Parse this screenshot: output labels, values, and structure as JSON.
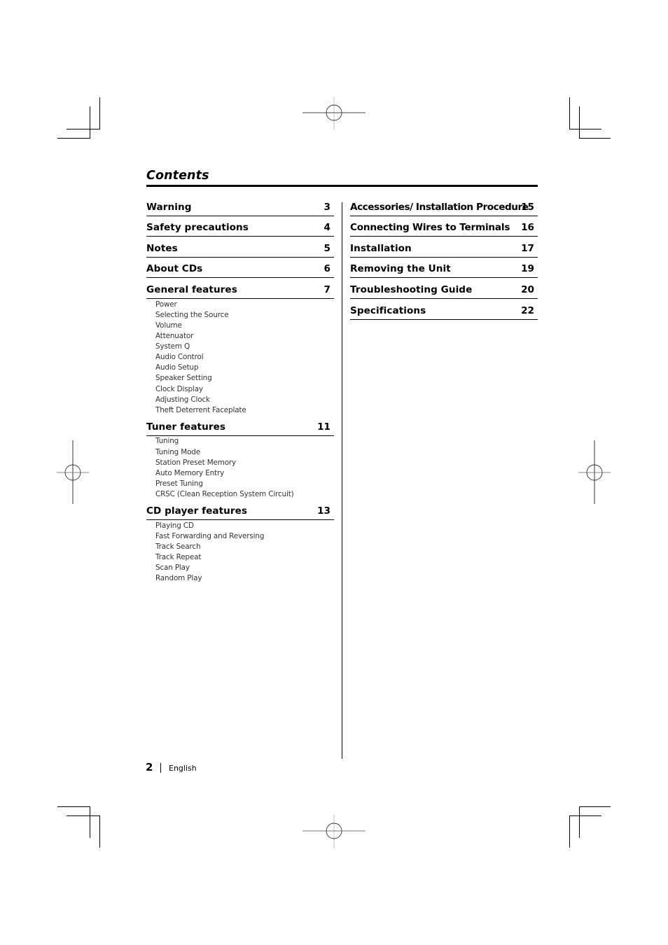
{
  "title": "Contents",
  "left_column": {
    "entries": [
      {
        "label": "Warning",
        "page": "3",
        "subitems": []
      },
      {
        "label": "Safety precautions",
        "page": "4",
        "subitems": []
      },
      {
        "label": "Notes",
        "page": "5",
        "subitems": []
      },
      {
        "label": "About CDs",
        "page": "6",
        "subitems": []
      },
      {
        "label": "General features",
        "page": "7",
        "subitems": [
          "Power",
          "Selecting the Source",
          "Volume",
          "Attenuator",
          "System Q",
          "Audio Control",
          "Audio Setup",
          "Speaker Setting",
          "Clock Display",
          "Adjusting Clock",
          "Theft Deterrent Faceplate"
        ]
      },
      {
        "label": "Tuner features",
        "page": "11",
        "subitems": [
          "Tuning",
          "Tuning Mode",
          "Station Preset Memory",
          "Auto Memory Entry",
          "Preset Tuning",
          "CRSC (Clean Reception System Circuit)"
        ]
      },
      {
        "label": "CD player features",
        "page": "13",
        "subitems": [
          "Playing CD",
          "Fast Forwarding and Reversing",
          "Track Search",
          "Track Repeat",
          "Scan Play",
          "Random Play"
        ]
      }
    ]
  },
  "right_column": {
    "entries": [
      {
        "label": "Accessories/ Installation Procedure",
        "page": "15"
      },
      {
        "label": "Connecting Wires to Terminals",
        "page": "16"
      },
      {
        "label": "Installation",
        "page": "17"
      },
      {
        "label": "Removing the Unit",
        "page": "19"
      },
      {
        "label": "Troubleshooting Guide",
        "page": "20"
      },
      {
        "label": "Specifications",
        "page": "22"
      }
    ]
  },
  "footer": {
    "page_number": "2",
    "language": "English"
  }
}
